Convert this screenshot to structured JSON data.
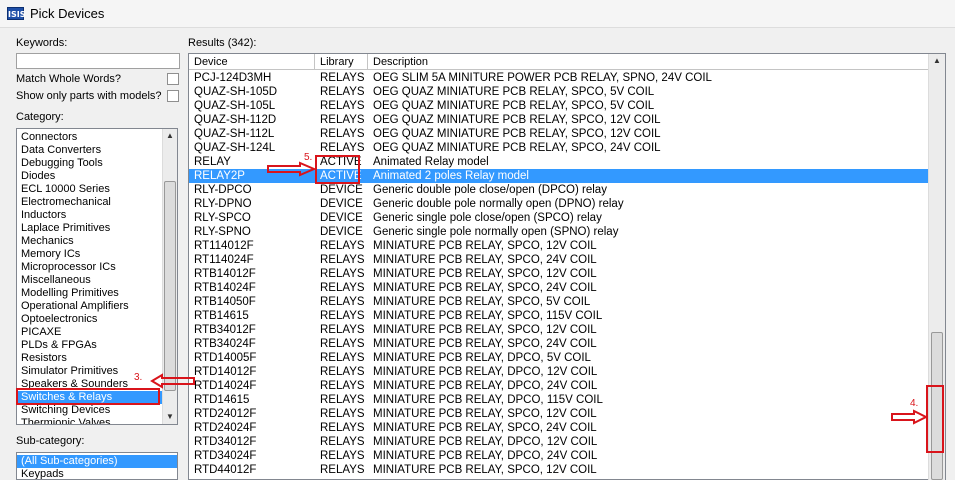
{
  "window": {
    "title": "Pick Devices",
    "icon_label": "ISIS"
  },
  "left_panel": {
    "keywords_label": "Keywords:",
    "keywords_value": "",
    "match_whole_words_label": "Match Whole Words?",
    "show_models_label": "Show only parts with models?",
    "category_label": "Category:",
    "categories": [
      "Connectors",
      "Data Converters",
      "Debugging Tools",
      "Diodes",
      "ECL 10000 Series",
      "Electromechanical",
      "Inductors",
      "Laplace Primitives",
      "Mechanics",
      "Memory ICs",
      "Microprocessor ICs",
      "Miscellaneous",
      "Modelling Primitives",
      "Operational Amplifiers",
      "Optoelectronics",
      "PICAXE",
      "PLDs & FPGAs",
      "Resistors",
      "Simulator Primitives",
      "Speakers & Sounders",
      "Switches & Relays",
      "Switching Devices",
      "Thermionic Valves"
    ],
    "selected_category": "Switches & Relays",
    "subcategory_label": "Sub-category:",
    "subcategories": [
      "(All Sub-categories)",
      "Keypads"
    ]
  },
  "results": {
    "label": "Results (342):",
    "columns": [
      "Device",
      "Library",
      "Description"
    ],
    "rows": [
      [
        "PCJ-124D3MH",
        "RELAYS",
        "OEG SLIM 5A MINITURE POWER PCB RELAY, SPNO, 24V COIL"
      ],
      [
        "QUAZ-SH-105D",
        "RELAYS",
        "OEG QUAZ MINIATURE PCB RELAY, SPCO, 5V COIL"
      ],
      [
        "QUAZ-SH-105L",
        "RELAYS",
        "OEG QUAZ MINIATURE PCB RELAY, SPCO, 5V COIL"
      ],
      [
        "QUAZ-SH-112D",
        "RELAYS",
        "OEG QUAZ MINIATURE PCB RELAY, SPCO, 12V COIL"
      ],
      [
        "QUAZ-SH-112L",
        "RELAYS",
        "OEG QUAZ MINIATURE PCB RELAY, SPCO, 12V COIL"
      ],
      [
        "QUAZ-SH-124L",
        "RELAYS",
        "OEG QUAZ MINIATURE PCB RELAY, SPCO, 24V COIL"
      ],
      [
        "RELAY",
        "ACTIVE",
        "Animated Relay model"
      ],
      [
        "RELAY2P",
        "ACTIVE",
        "Animated 2 poles Relay model"
      ],
      [
        "RLY-DPCO",
        "DEVICE",
        "Generic double pole close/open (DPCO) relay"
      ],
      [
        "RLY-DPNO",
        "DEVICE",
        "Generic double pole normally open (DPNO) relay"
      ],
      [
        "RLY-SPCO",
        "DEVICE",
        "Generic single pole close/open (SPCO) relay"
      ],
      [
        "RLY-SPNO",
        "DEVICE",
        "Generic single pole normally open (SPNO) relay"
      ],
      [
        "RT114012F",
        "RELAYS",
        "MINIATURE PCB RELAY, SPCO, 12V COIL"
      ],
      [
        "RT114024F",
        "RELAYS",
        "MINIATURE PCB RELAY, SPCO, 24V COIL"
      ],
      [
        "RTB14012F",
        "RELAYS",
        "MINIATURE PCB RELAY, SPCO, 12V COIL"
      ],
      [
        "RTB14024F",
        "RELAYS",
        "MINIATURE PCB RELAY, SPCO, 24V COIL"
      ],
      [
        "RTB14050F",
        "RELAYS",
        "MINIATURE PCB RELAY, SPCO, 5V COIL"
      ],
      [
        "RTB14615",
        "RELAYS",
        "MINIATURE PCB RELAY, SPCO, 115V COIL"
      ],
      [
        "RTB34012F",
        "RELAYS",
        "MINIATURE PCB RELAY, SPCO, 12V COIL"
      ],
      [
        "RTB34024F",
        "RELAYS",
        "MINIATURE PCB RELAY, SPCO, 24V COIL"
      ],
      [
        "RTD14005F",
        "RELAYS",
        "MINIATURE PCB RELAY, DPCO, 5V COIL"
      ],
      [
        "RTD14012F",
        "RELAYS",
        "MINIATURE PCB RELAY, DPCO, 12V COIL"
      ],
      [
        "RTD14024F",
        "RELAYS",
        "MINIATURE PCB RELAY, DPCO, 24V COIL"
      ],
      [
        "RTD14615",
        "RELAYS",
        "MINIATURE PCB RELAY, DPCO, 115V COIL"
      ],
      [
        "RTD24012F",
        "RELAYS",
        "MINIATURE PCB RELAY, SPCO, 12V COIL"
      ],
      [
        "RTD24024F",
        "RELAYS",
        "MINIATURE PCB RELAY, SPCO, 24V COIL"
      ],
      [
        "RTD34012F",
        "RELAYS",
        "MINIATURE PCB RELAY, DPCO, 12V COIL"
      ],
      [
        "RTD34024F",
        "RELAYS",
        "MINIATURE PCB RELAY, DPCO, 24V COIL"
      ],
      [
        "RTD44012F",
        "RELAYS",
        "MINIATURE PCB RELAY, SPCO, 12V COIL"
      ]
    ],
    "selected_device": "RELAY2P"
  },
  "annotations": {
    "step3": "3.",
    "step4": "4.",
    "step5": "5."
  },
  "colors": {
    "selection": "#3399ff",
    "annotation": "#d9141b"
  }
}
